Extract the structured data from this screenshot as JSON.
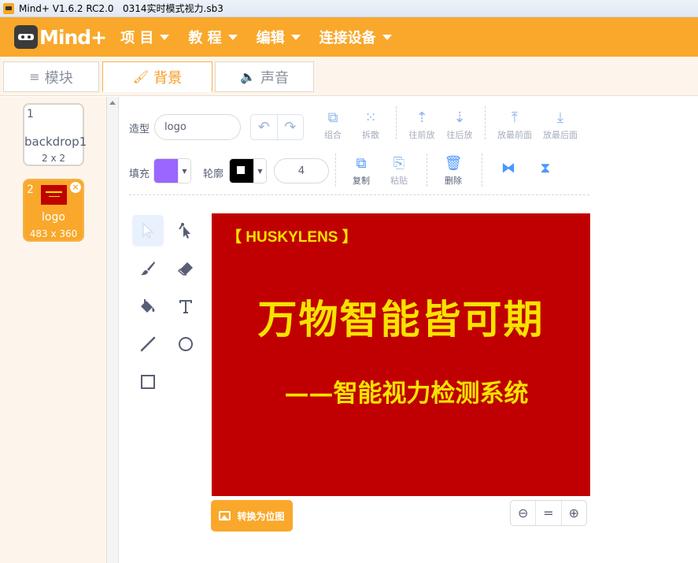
{
  "window": {
    "title": "Mind+ V1.6.2 RC2.0   0314实时模式视力.sb3"
  },
  "menubar": {
    "logo_text": "Mind+",
    "items": [
      {
        "label": "项 目"
      },
      {
        "label": "教 程"
      },
      {
        "label": "编辑"
      },
      {
        "label": "连接设备"
      }
    ]
  },
  "tabs": [
    {
      "label": "模块",
      "icon": "blocks-icon",
      "active": false
    },
    {
      "label": "背景",
      "icon": "paintbrush-icon",
      "active": true
    },
    {
      "label": "声音",
      "icon": "speaker-icon",
      "active": false
    }
  ],
  "costumes": [
    {
      "number": "1",
      "name": "backdrop1",
      "size": "2 x 2",
      "selected": false
    },
    {
      "number": "2",
      "name": "logo",
      "size": "483 x 360",
      "selected": true
    }
  ],
  "editor": {
    "costume_label": "造型",
    "costume_name": "logo",
    "fill_label": "填充",
    "fill_color": "#9966ff",
    "outline_label": "轮廓",
    "outline_color": "#000000",
    "outline_width": "4",
    "buttons": {
      "group": "组合",
      "ungroup": "拆散",
      "forward": "往前放",
      "backward": "往后放",
      "front": "放最前面",
      "back": "放最后面",
      "copy": "复制",
      "paste": "粘贴",
      "delete": "删除"
    },
    "convert_button": "转换为位图",
    "zoom": {
      "out": "−",
      "reset": "=",
      "in": "+"
    }
  },
  "canvas_content": {
    "brand": "【 HUSKYLENS 】",
    "headline": "万物智能皆可期",
    "subline": "——智能视力检测系统",
    "background": "#c00000",
    "text_color": "#f7e300"
  }
}
